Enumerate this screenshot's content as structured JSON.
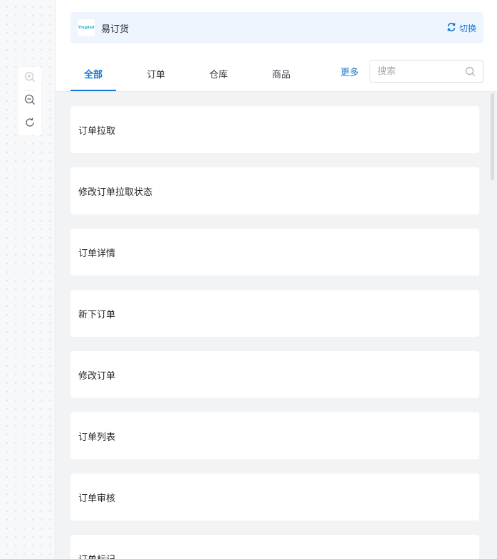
{
  "app": {
    "logo_text": "Yingdall",
    "name": "易订货",
    "switch_label": "切换"
  },
  "tabs": [
    {
      "label": "全部",
      "active": true
    },
    {
      "label": "订单",
      "active": false
    },
    {
      "label": "仓库",
      "active": false
    },
    {
      "label": "商品",
      "active": false
    }
  ],
  "more_label": "更多",
  "search": {
    "placeholder": "搜索",
    "value": ""
  },
  "items": [
    {
      "label": "订单拉取"
    },
    {
      "label": "修改订单拉取状态"
    },
    {
      "label": "订单详情"
    },
    {
      "label": "新下订单"
    },
    {
      "label": "修改订单"
    },
    {
      "label": "订单列表"
    },
    {
      "label": "订单审核"
    },
    {
      "label": "订单标记"
    }
  ],
  "zoom_tools": [
    "zoom-in-icon",
    "zoom-out-icon",
    "reset-icon"
  ],
  "colors": {
    "accent": "#1677d2",
    "app_bar_bg": "#eef5ff",
    "list_bg": "#f2f3f5"
  }
}
